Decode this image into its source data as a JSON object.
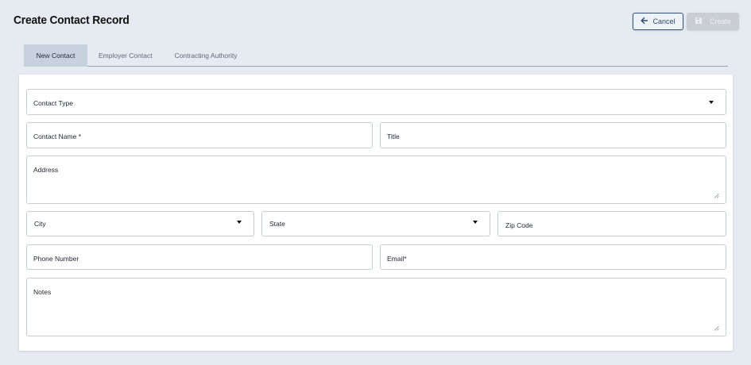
{
  "header": {
    "title": "Create Contact Record",
    "cancel_label": "Cancel",
    "create_label": "Create"
  },
  "tabs": [
    {
      "label": "New Contact",
      "active": true
    },
    {
      "label": "Employer Contact",
      "active": false
    },
    {
      "label": "Contracting Authority",
      "active": false
    }
  ],
  "form": {
    "contact_type": "Contact Type",
    "contact_name": "Contact Name *",
    "title": "Title",
    "address": "Address",
    "city": "City",
    "state": "State",
    "zip": "Zip Code",
    "phone": "Phone Number",
    "email": "Email*",
    "notes": "Notes"
  },
  "icons": {
    "cancel": "arrow-left-icon",
    "create": "save-icon",
    "dropdown": "caret-down-icon",
    "resize": "resize-grip-icon"
  },
  "colors": {
    "background": "#e6ebf1",
    "accent": "#34547d",
    "active_tab": "#c8d2de",
    "disabled_button": "#c9ced4"
  }
}
